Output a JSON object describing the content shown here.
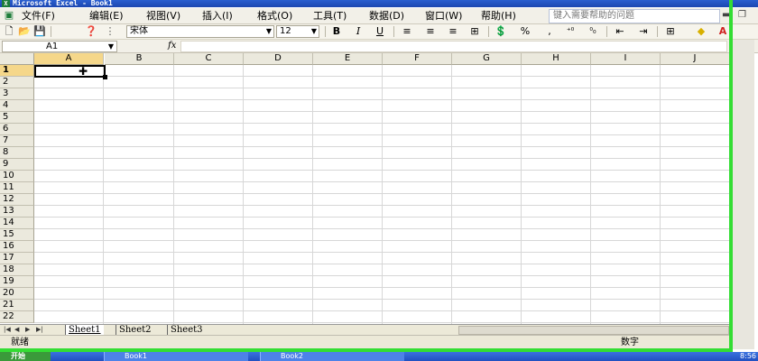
{
  "window": {
    "title": "Microsoft Excel - Book1"
  },
  "menu": {
    "items": [
      "文件(F)",
      "编辑(E)",
      "视图(V)",
      "插入(I)",
      "格式(O)",
      "工具(T)",
      "数据(D)",
      "窗口(W)",
      "帮助(H)"
    ],
    "help_placeholder": "键入需要帮助的问题"
  },
  "toolbar": {
    "font_name": "宋体",
    "font_size": "12",
    "bold": "B",
    "italic": "I",
    "underline": "U",
    "percent": "%"
  },
  "formula_bar": {
    "name_box": "A1",
    "fx": "fx",
    "value": ""
  },
  "grid": {
    "columns": [
      "A",
      "B",
      "C",
      "D",
      "E",
      "F",
      "G",
      "H",
      "I",
      "J"
    ],
    "rows": [
      "1",
      "2",
      "3",
      "4",
      "5",
      "6",
      "7",
      "8",
      "9",
      "10",
      "11",
      "12",
      "13",
      "14",
      "15",
      "16",
      "17",
      "18",
      "19",
      "20",
      "21",
      "22"
    ],
    "active_cell": "A1"
  },
  "sheets": {
    "tabs": [
      "Sheet1",
      "Sheet2",
      "Sheet3"
    ],
    "active": "Sheet1"
  },
  "status": {
    "left": "就绪",
    "right": "数字"
  },
  "taskbar": {
    "start": "开始",
    "tasks": [
      "Book1",
      "Book2"
    ],
    "clock": "8:56"
  },
  "colors": {
    "green_frame": "#33dd33",
    "title_blue": "#1c46b0",
    "selection_header": "#f5d78a"
  }
}
